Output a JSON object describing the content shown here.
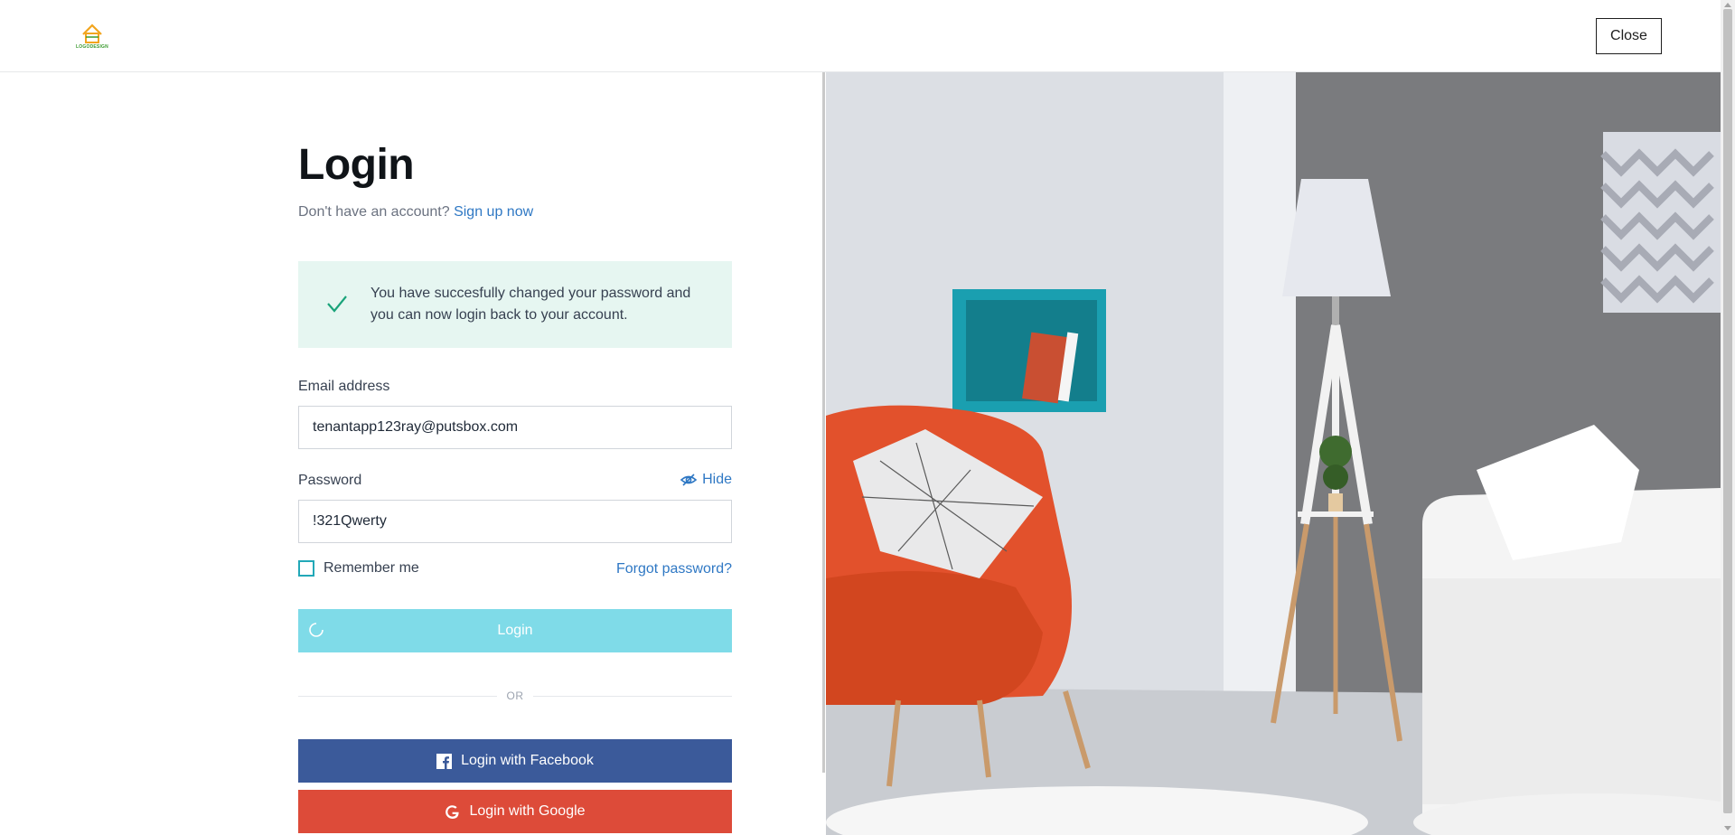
{
  "header": {
    "logo_text": "LOGODESIGN",
    "close_label": "Close"
  },
  "form": {
    "title": "Login",
    "signup_prompt": "Don't have an account?",
    "signup_link": "Sign up now",
    "alert_message": "You have succesfully changed your password and you can now login back to your account.",
    "email_label": "Email address",
    "email_value": "tenantapp123ray@putsbox.com",
    "password_label": "Password",
    "password_value": "!321Qwerty",
    "hide_label": "Hide",
    "remember_label": "Remember me",
    "forgot_label": "Forgot password?",
    "login_label": "Login",
    "or_label": "OR",
    "facebook_label": "Login with Facebook",
    "google_label": "Login with Google"
  },
  "colors": {
    "accent_link": "#2f78c4",
    "login_button": "#7fdbe8",
    "facebook": "#3b5a9a",
    "google": "#dd4b39",
    "alert_bg": "#e6f6f1",
    "check": "#1aa37a"
  }
}
